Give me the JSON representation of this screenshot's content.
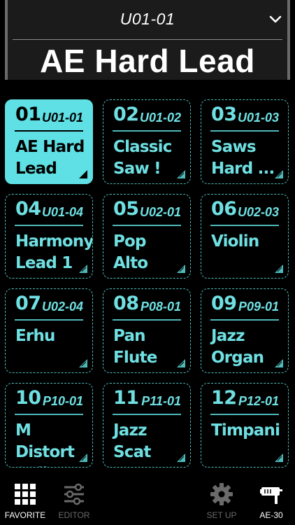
{
  "header": {
    "patch_code": "U01-01",
    "patch_name": "AE Hard Lead"
  },
  "tiles": [
    {
      "num": "01",
      "code": "U01-01",
      "name": "AE Hard\nLead",
      "selected": true
    },
    {
      "num": "02",
      "code": "U01-02",
      "name": "Classic\nSaw !",
      "selected": false
    },
    {
      "num": "03",
      "code": "U01-03",
      "name": "Saws\nHard ...",
      "selected": false
    },
    {
      "num": "04",
      "code": "U01-04",
      "name": "Harmony\nLead 1",
      "selected": false
    },
    {
      "num": "05",
      "code": "U02-01",
      "name": "Pop Alto\nSax",
      "selected": false
    },
    {
      "num": "06",
      "code": "U02-03",
      "name": "Violin",
      "selected": false
    },
    {
      "num": "07",
      "code": "U02-04",
      "name": "Erhu",
      "selected": false
    },
    {
      "num": "08",
      "code": "P08-01",
      "name": "Pan Flute\nMT",
      "selected": false
    },
    {
      "num": "09",
      "code": "P09-01",
      "name": "Jazz\nOrgan ...",
      "selected": false
    },
    {
      "num": "10",
      "code": "P10-01",
      "name": "M Distort\nSplit",
      "selected": false
    },
    {
      "num": "11",
      "code": "P11-01",
      "name": "Jazz\nScat",
      "selected": false
    },
    {
      "num": "12",
      "code": "P12-01",
      "name": "Timpani",
      "selected": false
    }
  ],
  "nav": {
    "favorite": {
      "label": "FAVORITE",
      "icon": "grid-icon",
      "active": true
    },
    "editor": {
      "label": "EDITOR",
      "icon": "sliders-icon",
      "active": false
    },
    "setup": {
      "label": "SET UP",
      "icon": "gear-icon",
      "active": false
    },
    "device": {
      "label": "AE-30",
      "icon": "instrument-icon",
      "active": true
    }
  },
  "colors": {
    "accent": "#5ee0e4",
    "tile_text": "#6fe0e2",
    "tile_border": "#4fb9b9",
    "nav_inactive": "#6a6a6a",
    "background": "#000000"
  }
}
